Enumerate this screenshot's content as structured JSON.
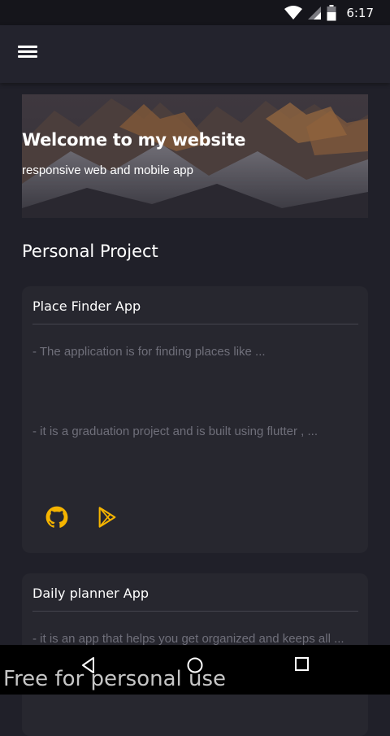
{
  "status_bar": {
    "time": "6:17",
    "icons": [
      "wifi-icon",
      "cell-signal-icon",
      "battery-icon"
    ]
  },
  "app_bar": {
    "menu_icon": "hamburger-menu-icon"
  },
  "hero": {
    "title": "Welcome to my website",
    "subtitle": "responsive web and mobile app"
  },
  "section": {
    "title": "Personal Project"
  },
  "projects": [
    {
      "title": "Place Finder App",
      "description_1": "- The application is for finding places like ...",
      "description_2": "- it is a graduation project and is built using flutter , ...",
      "links": [
        "github-icon",
        "google-play-icon"
      ]
    },
    {
      "title": "Daily planner App",
      "description_1": "- it is an app that helps you get organized and keeps all ..."
    }
  ],
  "colors": {
    "background": "#202029",
    "card": "#27272f",
    "accent": "#f5b400",
    "muted_text": "#6f6f7a"
  },
  "nav_bar": {
    "buttons": [
      "back-icon",
      "home-icon",
      "recents-icon"
    ]
  },
  "watermark": "Free for personal use"
}
